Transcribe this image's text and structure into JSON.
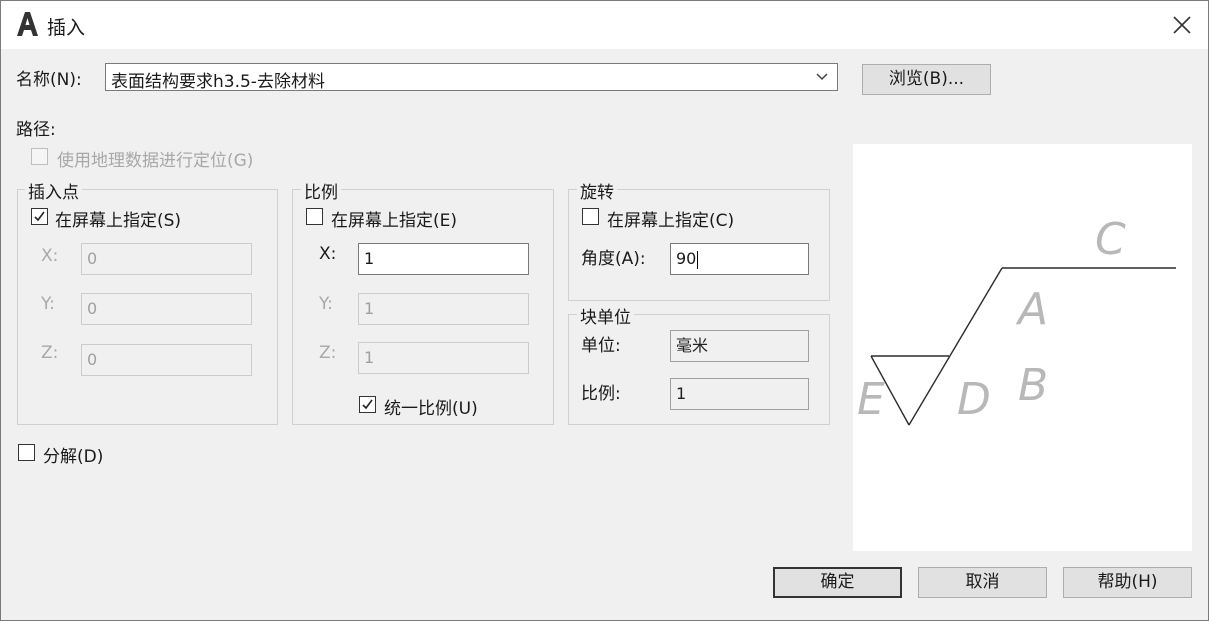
{
  "window": {
    "title": "插入",
    "app_icon": "autocad-a-icon",
    "close_icon": "close-x-icon"
  },
  "name": {
    "label": "名称(N):",
    "value": "表面结构要求h3.5-去除材料",
    "dropdown_icon": "chevron-down-icon"
  },
  "browse_button": "浏览(B)...",
  "path": {
    "label": "路径:"
  },
  "geo": {
    "label": "使用地理数据进行定位(G)",
    "checked": false,
    "enabled": false
  },
  "insertion_point": {
    "title": "插入点",
    "specify_on_screen": {
      "label": "在屏幕上指定(S)",
      "checked": true
    },
    "x": {
      "label": "X:",
      "value": "0"
    },
    "y": {
      "label": "Y:",
      "value": "0"
    },
    "z": {
      "label": "Z:",
      "value": "0"
    }
  },
  "scale": {
    "title": "比例",
    "specify_on_screen": {
      "label": "在屏幕上指定(E)",
      "checked": false
    },
    "x": {
      "label": "X:",
      "value": "1"
    },
    "y": {
      "label": "Y:",
      "value": "1"
    },
    "z": {
      "label": "Z:",
      "value": "1"
    },
    "uniform": {
      "label": "统一比例(U)",
      "checked": true
    }
  },
  "rotation": {
    "title": "旋转",
    "specify_on_screen": {
      "label": "在屏幕上指定(C)",
      "checked": false
    },
    "angle": {
      "label": "角度(A):",
      "value": "90"
    }
  },
  "block_unit": {
    "title": "块单位",
    "unit": {
      "label": "单位:",
      "value": "毫米"
    },
    "factor": {
      "label": "比例:",
      "value": "1"
    }
  },
  "explode": {
    "label": "分解(D)",
    "checked": false
  },
  "preview": {
    "labels": {
      "c": "C",
      "a": "A",
      "d": "D",
      "b": "B",
      "e": "E"
    }
  },
  "buttons": {
    "ok": "确定",
    "cancel": "取消",
    "help": "帮助(H)"
  }
}
